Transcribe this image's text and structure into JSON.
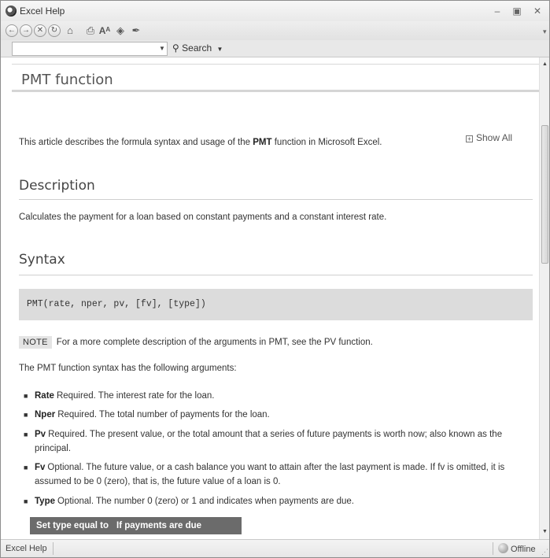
{
  "window": {
    "title": "Excel Help",
    "minimize_icon": "minimize-icon",
    "maximize_icon": "maximize-icon",
    "close_icon": "close-icon"
  },
  "toolbar": {
    "buttons": [
      "back-icon",
      "forward-icon",
      "stop-icon",
      "refresh-icon",
      "home-icon",
      "print-icon",
      "font-size-icon",
      "table-of-contents-icon",
      "keep-on-top-icon"
    ]
  },
  "search": {
    "input_value": "",
    "button_label": "Search"
  },
  "article": {
    "title": "PMT function",
    "show_all": "Show All",
    "intro_pre": "This article describes the formula syntax and usage of the ",
    "intro_bold": "PMT",
    "intro_post": " function in Microsoft Excel.",
    "description_heading": "Description",
    "description_text": "Calculates the payment for a loan based on constant payments and a constant interest rate.",
    "syntax_heading": "Syntax",
    "syntax_code": "PMT(rate, nper, pv, [fv], [type])",
    "note_label": "NOTE",
    "note_text": "For a more complete description of the arguments in PMT, see the PV function.",
    "args_intro": "The PMT function syntax has the following arguments:",
    "arguments": [
      {
        "name": "Rate",
        "text": "Required. The interest rate for the loan."
      },
      {
        "name": "Nper",
        "text": "Required. The total number of payments for the loan."
      },
      {
        "name": "Pv",
        "text": "Required. The present value, or the total amount that a series of future payments is worth now; also known as the principal."
      },
      {
        "name": "Fv",
        "text": "Optional. The future value, or a cash balance you want to attain after the last payment is made. If fv is omitted, it is assumed to be 0 (zero), that is, the future value of a loan is 0."
      },
      {
        "name": "Type",
        "text": "Optional. The number 0 (zero) or 1 and indicates when payments are due."
      }
    ],
    "type_table_headers": [
      "Set type equal to",
      "If payments are due"
    ]
  },
  "status": {
    "left": "Excel Help",
    "right": "Offline"
  }
}
